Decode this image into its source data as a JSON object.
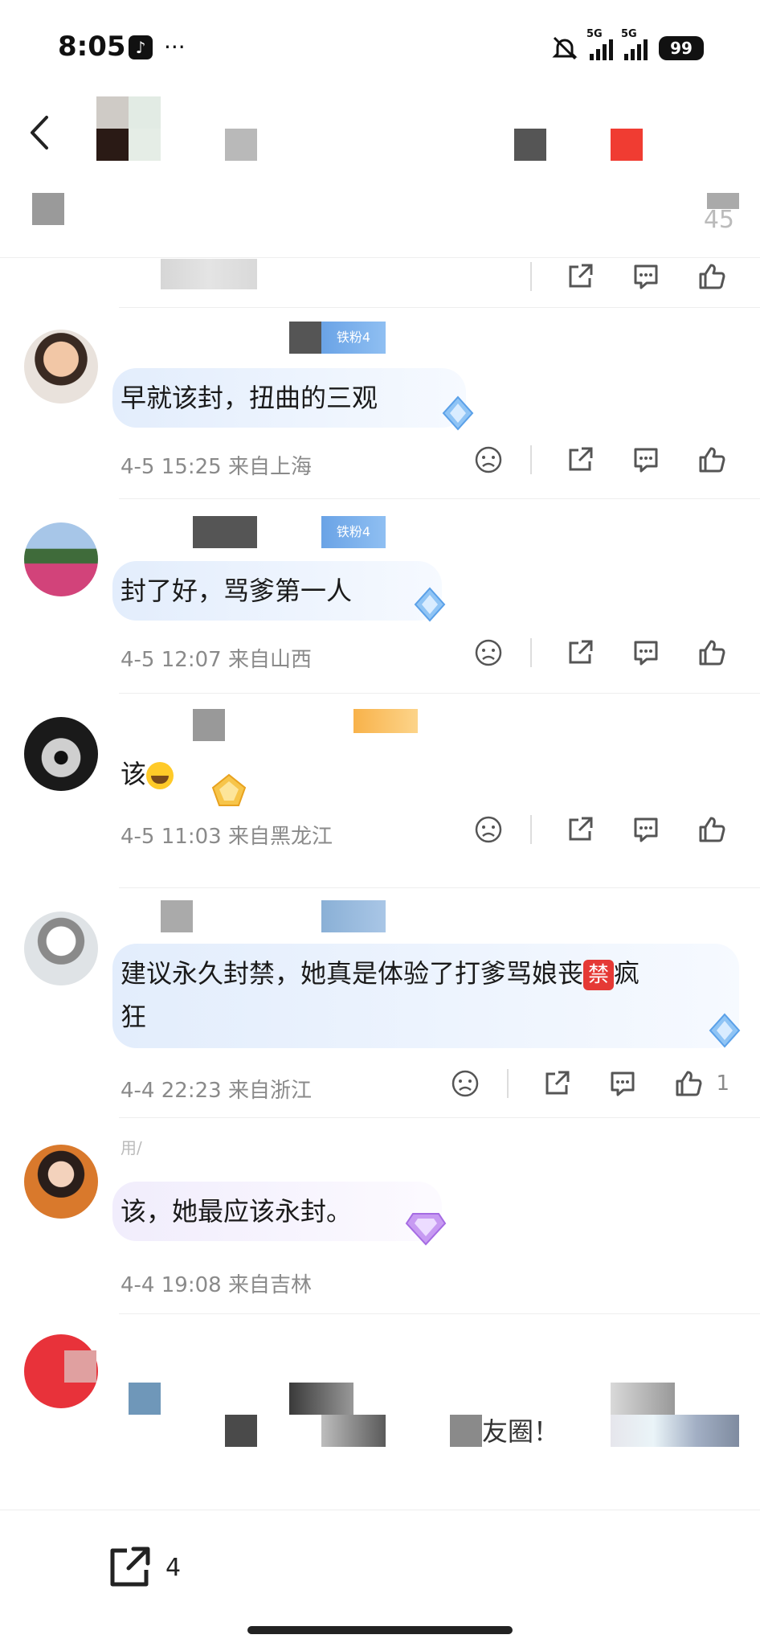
{
  "status_bar": {
    "time": "8:05",
    "dots": "···",
    "net1": "5G",
    "net2": "5G",
    "battery": "99"
  },
  "header": {
    "post_count": "45"
  },
  "comments": [
    {
      "text": "早就该封，扭曲的三观",
      "date": "4-5 15:25",
      "location": "来自上海",
      "badge": "铁粉4",
      "likes": ""
    },
    {
      "text": "封了好，骂爹第一人",
      "date": "4-5 12:07",
      "location": "来自山西",
      "badge": "铁粉4",
      "likes": ""
    },
    {
      "text": "该",
      "date": "4-5 11:03",
      "location": "来自黑龙江",
      "badge": "",
      "likes": ""
    },
    {
      "text_part1": "建议永久封禁，她真是体验了打爹骂娘丧",
      "banned": "禁",
      "text_part2": "疯",
      "text_line2": "狂",
      "date": "4-4 22:23",
      "location": "来自浙江",
      "likes": "1"
    },
    {
      "text": "该，她最应该永封。",
      "date": "4-4 19:08",
      "location": "来自吉林",
      "name_fragment": "用/"
    }
  ],
  "partial_comment": {
    "text_fragment": "友圈！"
  },
  "bottom": {
    "share_count": "4"
  }
}
